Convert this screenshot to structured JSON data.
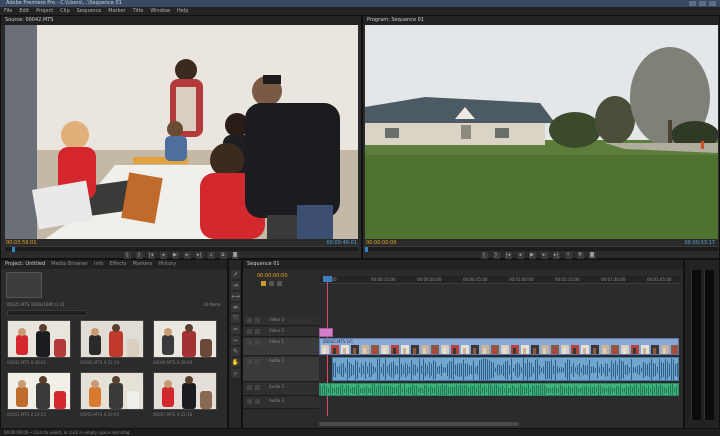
{
  "app": {
    "title": "Adobe Premiere Pro - C:\\Users\\...\\Sequence 01",
    "menu": [
      "File",
      "Edit",
      "Project",
      "Clip",
      "Sequence",
      "Marker",
      "Title",
      "Window",
      "Help"
    ]
  },
  "source_monitor": {
    "tab": "Source: 00042.MTS",
    "timecode_in": "00:03:59:01",
    "timecode_out": "00:00:46:01",
    "progress": 0.02
  },
  "program_monitor": {
    "tab": "Program: Sequence 01",
    "timecode_in": "00:00:00:00",
    "timecode_out": "00:00:53:17",
    "progress": 0.0
  },
  "project_panel": {
    "tabs": [
      "Project: Untitled",
      "Media Browser",
      "Info",
      "Effects",
      "Markers",
      "History"
    ],
    "bin_label": "00125.MTS 1920x1080 (1.0)",
    "item_count": "10 Items",
    "thumbnails": [
      {
        "label": "00042.MTS  0:46:01",
        "scene": "family"
      },
      {
        "label": "00045.MTS  0:32:14",
        "scene": "family2"
      },
      {
        "label": "00049.MTS  0:28:09",
        "scene": "family3"
      },
      {
        "label": "00051.MTS  0:14:22",
        "scene": "board"
      },
      {
        "label": "00053.MTS  0:19:05",
        "scene": "table"
      },
      {
        "label": "00057.MTS  0:22:18",
        "scene": "family4"
      }
    ]
  },
  "timeline": {
    "tab": "Sequence 01",
    "timecode": "00:00:00:00",
    "ruler": [
      "00:00",
      "00:00:15:00",
      "00:00:30:00",
      "00:00:45:00",
      "00:01:00:00",
      "00:01:15:00",
      "00:01:30:00",
      "00:01:45:00"
    ],
    "tracks": [
      "Video 3",
      "Video 2",
      "Video 1",
      "Audio 1",
      "Audio 2",
      "Audio 3"
    ],
    "clip_label": "00042.MTS [V]"
  },
  "status_bar": {
    "text": "00:00:00:00 • Click to select, or click in empty space and drag"
  }
}
